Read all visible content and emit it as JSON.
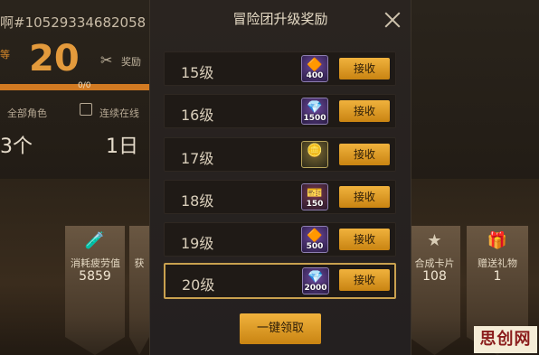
{
  "background": {
    "player_name": "啊#10529334682058",
    "level_tag": "等",
    "level": "20",
    "tool_label": "奖励",
    "progress_text": "0/0",
    "stats": {
      "all_roles_label": "全部角色",
      "all_roles_value": "3个",
      "login_label": "连续在线",
      "login_value": "1日"
    },
    "banners": [
      {
        "label": "消耗疲劳值",
        "value": "5859",
        "icon": "potion-icon"
      },
      {
        "label": "获",
        "value": "",
        "icon": ""
      },
      {
        "label": "合成卡片",
        "value": "108",
        "icon": "star-icon"
      },
      {
        "label": "赠送礼物",
        "value": "1",
        "icon": "gift-icon"
      }
    ],
    "watermark": "思创网"
  },
  "modal": {
    "title": "冒险团升级奖励",
    "close_icon": "close-icon",
    "claim_label": "接收",
    "one_key_label": "一键领取",
    "rows": [
      {
        "level": "15级",
        "reward_qty": "400",
        "reward_icon": "gem-icon",
        "rarity": "purple"
      },
      {
        "level": "16级",
        "reward_qty": "1500",
        "reward_icon": "crystal-icon",
        "rarity": "purple"
      },
      {
        "level": "17级",
        "reward_qty": "",
        "reward_icon": "gold-coins-icon",
        "rarity": "gold"
      },
      {
        "level": "18级",
        "reward_qty": "150",
        "reward_icon": "ticket-icon",
        "rarity": "red"
      },
      {
        "level": "19级",
        "reward_qty": "500",
        "reward_icon": "gem-icon",
        "rarity": "purple"
      },
      {
        "level": "20级",
        "reward_qty": "2000",
        "reward_icon": "crystal-icon",
        "rarity": "purple",
        "selected": true
      }
    ]
  }
}
